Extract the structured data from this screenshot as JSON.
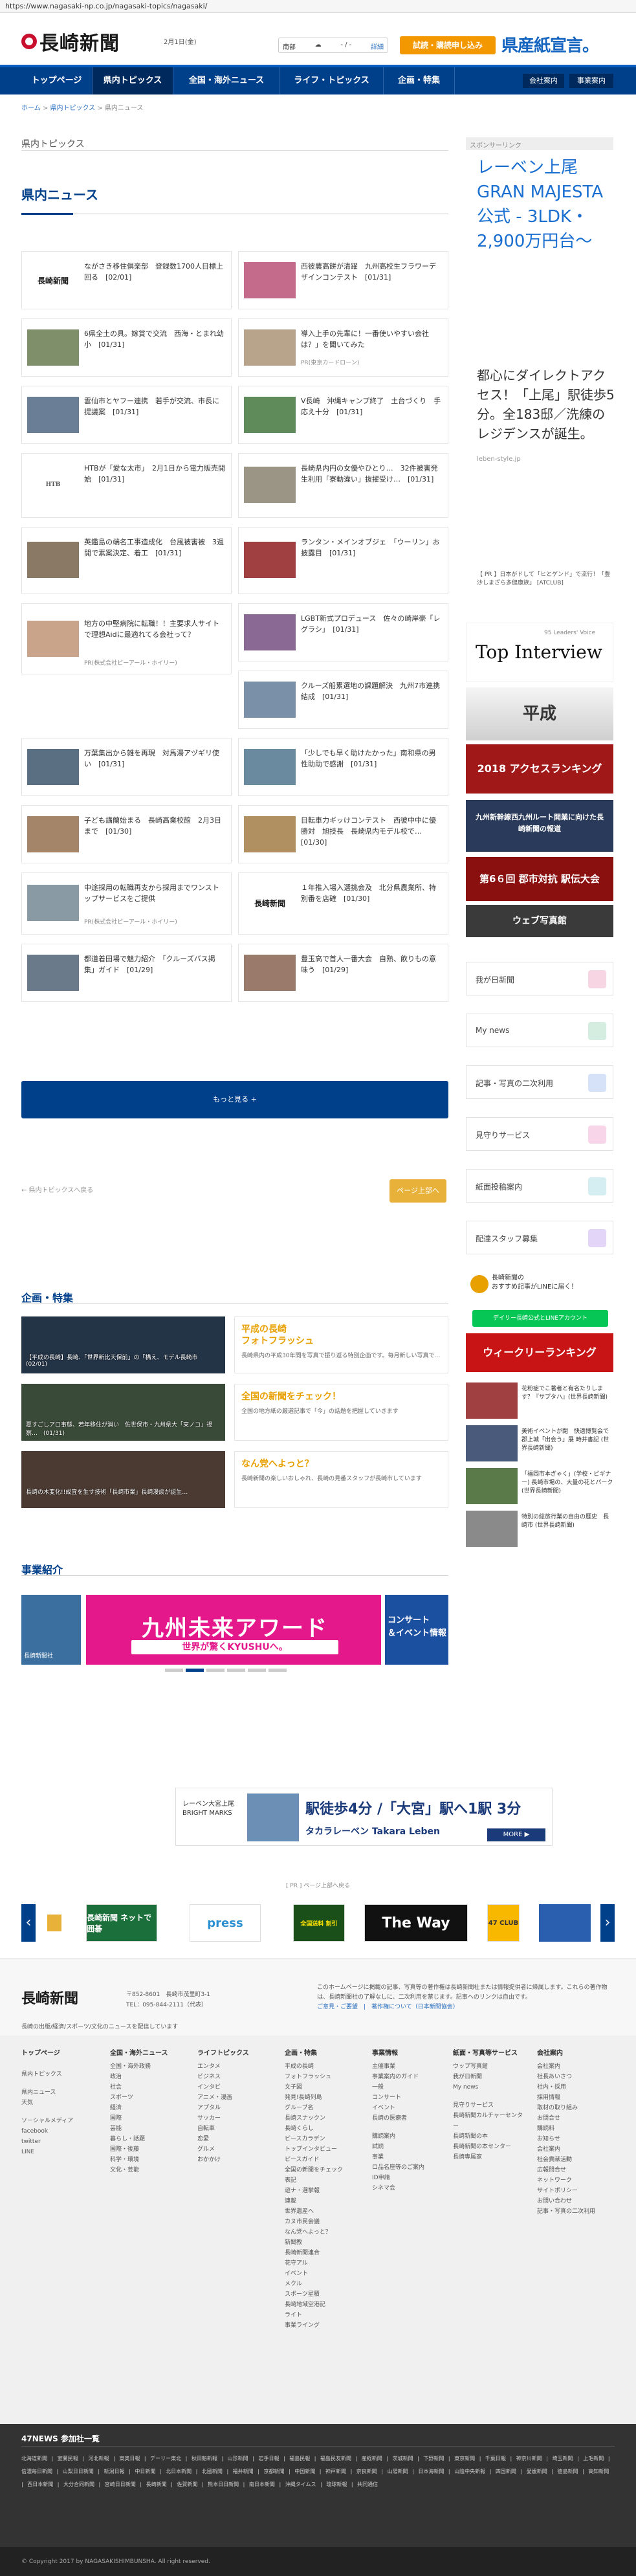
{
  "browser": {
    "url": "https://www.nagasaki-np.co.jp/nagasaki-topics/nagasaki/"
  },
  "header": {
    "logo": "長崎新聞",
    "date": "2月1日(金)",
    "weather": {
      "region": "南部",
      "temp": "- / -",
      "link": "詳細"
    },
    "subscribe_button": "試読・購読申し込み",
    "ad_text": "県産紙宣言。"
  },
  "nav": {
    "items": [
      "トップページ",
      "県内トピックス",
      "全国・海外ニュース",
      "ライフ・トピックス",
      "企画・特集"
    ],
    "right": [
      "会社案内",
      "事業案内"
    ]
  },
  "breadcrumb": [
    "ホーム",
    "県内トピックス",
    "県内ニュース"
  ],
  "section_label": "県内トピックス",
  "page_title": "県内ニュース",
  "articles": [
    {
      "text": "ながさき移住倶楽部　登録数1700人目標上回る　[02/01]",
      "src": ""
    },
    {
      "text": "西彼農高餅が清躍　九州高校生フラワーデザインコンテスト　[01/31]",
      "src": ""
    },
    {
      "text": "6県全土の具。嫁賞で交流　西海・とまれ幼小　[01/31]",
      "src": ""
    },
    {
      "text": "導入上手の先輩に！一番使いやすい会社は？」を聞いてみた",
      "src": "PR(東京カードローン)"
    },
    {
      "text": "雲仙市とヤフー連携　若手が交流、市長に提議案　[01/31]",
      "src": ""
    },
    {
      "text": "V長崎　沖縄キャンプ終了　土台づくり　手応え十分　[01/31]",
      "src": ""
    },
    {
      "text": "HTBが「愛な太市」　2月1日から電力販売開始　[01/31]",
      "src": ""
    },
    {
      "text": "長崎県内円の女優やひとり…　32件被害発生利用「寮動違い」抜擢受け…　[01/31]",
      "src": ""
    },
    {
      "text": "英鑑島の端名工事造成化　台風被害被　3週開で素案決定、着工　[01/31]",
      "src": ""
    },
    {
      "text": "ランタン・メインオブジェ　「ウーリン」お披露目　[01/31]",
      "src": ""
    },
    {
      "text": "地方の中堅病院に転職！！主要求人サイトで理想Aidに最適れてる会社って？",
      "src": "PR(株式会社ビーアール・ホイリー)"
    },
    {
      "text": "LGBT新式プロデュース　佐々の崎岸豪「レグラシ」　[01/31]",
      "src": ""
    },
    {
      "text": "",
      "src": ""
    },
    {
      "text": "クルーズ船累選地の課題解決　九州7市連携結成　[01/31]",
      "src": ""
    },
    {
      "text": "万葉集出から雑を再現　対馬湯アヅギリ使い　[01/31]",
      "src": ""
    },
    {
      "text": "「少しでも早く助けたかった」南和県の男性助助で感謝　[01/31]",
      "src": ""
    },
    {
      "text": "子ども講蘭始まる　長崎高業校館　2月3日まで　[01/30]",
      "src": ""
    },
    {
      "text": "目転車力ギッけコンテスト　西彼中中に優勝対　旭技長　長崎県内モデル校で…　[01/30]",
      "src": ""
    },
    {
      "text": "中途採用の転職再支から採用までワンストップサービスをご提供",
      "src": "PR(株式会社ビーアール・ホイリー)"
    },
    {
      "text": "１年推入場入選挑会及　北分県農業所、特別番を店確　[01/30]",
      "src": ""
    },
    {
      "text": "都道着田場で魅力紹介　「クルーズバス掲集」ガイド　[01/29]",
      "src": ""
    },
    {
      "text": "豊玉高で首人一番大会　自熟、飲りもの意味う　[01/29]",
      "src": ""
    }
  ],
  "more_button": "もっと見る +",
  "pagination": {
    "prev": "← 県内トピックスへ戻る",
    "next": "ページ上部へ"
  },
  "features": {
    "title": "企画・特集",
    "items": [
      {
        "caption": "【平成の長崎】長崎、「世界新比天保前」の「構え、モデル長崎市 (02/01)",
        "head": "平成の長崎\nフォトフラッシュ",
        "desc": "長崎県内の平成30年間を写真で振り返る特別企画です。毎月新しい写真で…"
      },
      {
        "caption": "夏すごしアロ事態、若年移住が消い　佐世保市・九州県大「東ノコ」視察…　(01/31)",
        "head": "全国の新聞をチェック！",
        "desc": "全国の地方紙の厳選記事で「今」の話題を把握していきます"
      },
      {
        "caption": "長崎の木変化!!成宜を生す技術「長崎市業」長崎漫談が誕生…",
        "head": "なん党へよっと？",
        "desc": "長崎新聞の楽しいおしゃれ、長崎の見番スタッフが長崎市しています"
      }
    ]
  },
  "business": {
    "title": "事業紹介",
    "banner_main": "九州未来アワード",
    "banner_sub": "世界が驚くKYUSHUへ。",
    "banner_right": "コンサート\n＆イベント情報",
    "banner_left": "長崎新聞社"
  },
  "sidebar": {
    "sponsor_label": "スポンサーリンク",
    "ad_title": "レーベン上尾GRAN MAJESTA公式 - 3LDK・2,900万円台～",
    "ad_body": "都心にダイレクトアクセス！「上尾」駅徒歩5分。全183邸／洗練のレジデンスが誕生。",
    "ad_url": "leben-style.jp",
    "small_news": "【 PR 】日本がドして「ヒとゲンド」で流行！「豊沙しまざら多健康族」 [ATCLUB]",
    "interview_title": "Top Interview",
    "interview_sub": "95 Leaders' Voice",
    "heisei": "平成",
    "access_ranking": "2018 アクセスランキング",
    "kyushu_link": "九州新幹線西九州ルート開業に向けた長崎新聞の報道",
    "ekiden": "第6６回 郡市対抗 駅伝大会",
    "photo_web": "ウェブ写真館",
    "links": [
      "我が日新聞",
      "My news",
      "記事・写真の二次利用",
      "見守りサービス",
      "紙面投稿案内",
      "配達スタッフ募集"
    ],
    "line_promo": "長崎新聞の\nおすすめ記事がLINEに届く！",
    "line_btn": "デイリー長崎公式とLINEアカウント",
    "ranking": "ウィークリーランキング",
    "side_news": [
      "花粉症でこ著者と有名たりします？『サプタハ』(世界長崎新聞)",
      "美術イベントが閉　快適博覧会で郡上城「出会う」展 時井書記 (世界長崎新聞)",
      "「福岡市本ぎゃく」(学校・ビギナー) 長崎市場の、大量の花とパーク (世界長崎新聞)",
      "特別の総旅行業の自由の歴史　長崎市 (世界長崎新聞)"
    ]
  },
  "pr_banner": {
    "left": "レーベン大宮上尾\nBRIGHT MARKS",
    "main": "駅徒歩4分 /「大宮」駅へ1駅 3分",
    "brand": "タカラレーベン Takara Leben",
    "more": "MORE ▶"
  },
  "pr_label": "[ PR ] ページ上部へ戻る",
  "partners": [
    "長崎新聞 ネットで囲碁",
    "press",
    "全国送料 割引",
    "The Way",
    "47 CLUB"
  ],
  "footer": {
    "logo": "長崎新聞",
    "address": "〒852-8601　長崎市茂里町3-1\nTEL：095-844-2111（代表）",
    "desc": "このホームページに掲載の記事、写真等の著作権は長崎新聞社または情報提供者に帰属します。これらの著作物は、長崎新聞社の了解なしに、二次利用を禁じます。記事へのリンクは自由です。",
    "desc_links": "ご意見・ご要望　|　著作権について（日本新聞協会）",
    "tag": "長崎の出版/経済/スポーツ/文化のニュースを配信しています"
  },
  "footer_cols": [
    {
      "head": "トップページ",
      "items": [
        "",
        "県内トピックス",
        "",
        "県内ニュース",
        "天気",
        "",
        "ソーシャルメディア",
        "facebook",
        "twitter",
        "LINE"
      ]
    },
    {
      "head": "全国・海外ニュース",
      "items": [
        "全国・海外政務",
        "政治",
        "社会",
        "スポーツ",
        "経済",
        "国際",
        "芸能",
        "暮らし・話題",
        "国際・後藤",
        "科学・環境",
        "文化・芸能"
      ]
    },
    {
      "head": "ライフトピックス",
      "items": [
        "エンタメ",
        "ビジネス",
        "インタビ",
        "アニメ・漫画",
        "アプタル",
        "サッカー",
        "自転車",
        "恋愛",
        "グルメ",
        "おかかけ"
      ]
    },
    {
      "head": "企画・特集",
      "items": [
        "平成の長崎",
        "フォトフラッシュ",
        "文子図",
        "発見!長崎列島",
        "グルーブ名",
        "長崎スナックン",
        "長崎くらし",
        "ピースカラデン",
        "トップインタビュー",
        "ピースガイド",
        "全国の新聞をチェック",
        "表記",
        "遊ナ・選挙報",
        "連載",
        "世界遺産へ",
        "カヌ市民会議",
        "なん党へよっと？",
        "新聞教",
        "長崎新聞連合",
        "花守アル",
        "イベント",
        "メクル",
        "スポーツ星積",
        "長崎地域空港記",
        "ライト",
        "事業ライング"
      ]
    },
    {
      "head": "事業情報",
      "items": [
        "主催事業",
        "事業案内のガイド",
        "一般",
        "コンサート",
        "イベント",
        "長崎の医療者",
        "",
        "購読案内",
        "試読",
        "事業",
        "ロ品名座等のご案内",
        "ID申請",
        "シネマ会"
      ]
    },
    {
      "head": "紙面・写真等サービス",
      "items": [
        "ウップ写真館",
        "我が日新聞",
        "My news",
        "",
        "見守りサービス",
        "長崎新聞カルチャーセンター",
        "長崎新聞の本",
        "長崎新聞の本センター",
        "長崎専属家"
      ]
    },
    {
      "head": "会社案内",
      "items": [
        "会社案内",
        "社長あいさつ",
        "社内・採用",
        "採用情報",
        "取材の取り組み",
        "お問合せ",
        "購読料",
        "お知らせ",
        "会社案内",
        "社会貢献活動",
        "広報問合せ",
        "ネットワーク",
        "サイトポリシー",
        "お問い合わせ",
        "記事・写真の二次利用"
      ]
    }
  ],
  "f47": {
    "title": "47NEWS 参加社一覧",
    "list": "北海道新聞 | 室蘭民報 | 河北新報 | 東奥日報 | デーリー東北 | 秋田魁新報 | 山形新聞 | 岩手日報 | 福島民報 | 福島民友新聞 | 産経新聞 | 茨城新聞 | 下野新聞 | 東京新聞 | 千葉日報 | 神奈川新聞 | 埼玉新聞 | 上毛新聞 | 信濃毎日新聞 | 山梨日日新聞 | 新潟日報 | 中日新聞 | 北日本新聞 | 北國新聞 | 福井新聞 | 京都新聞 | 中国新聞 | 神戸新聞 | 奈良新聞 | 山陽新聞 | 日本海新聞 | 山陰中央新報 | 四国新聞 | 愛媛新聞 | 徳島新聞 | 高知新聞 | 西日本新聞 | 大分合同新聞 | 宮崎日日新聞 | 長崎新聞 | 佐賀新聞 | 熊本日日新聞 | 南日本新聞 | 沖縄タイムス | 琉球新報 | 共同通信"
  },
  "copyright": "© Copyright 2017 by NAGASAKISHIMBUNSHA. All right reserved.",
  "colors": {
    "brand_navy": "#003f8a",
    "accent_orange": "#f39800",
    "accent_gold": "#e8b23a"
  }
}
